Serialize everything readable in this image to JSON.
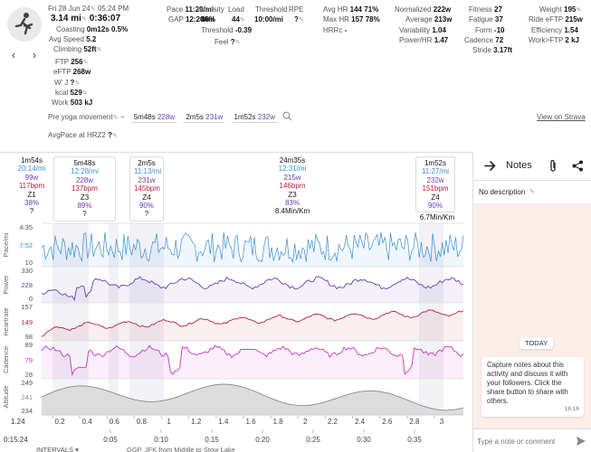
{
  "activity": {
    "date": "Fri 28 Jun 24",
    "time": "05:24 PM",
    "distance": "3.14 mi",
    "duration": "0:36:07",
    "coasting_label": "Coasting",
    "coasting_value": "0m12s",
    "coasting_pct": "0.5%",
    "avg_speed_label": "Avg Speed",
    "avg_speed": "5.2",
    "climbing_label": "Climbing",
    "climbing": "52ft",
    "ftp_label": "FTP",
    "ftp": "256",
    "eftp_label": "eFTP",
    "eftp": "268w",
    "wj_label": "W' J",
    "wj": "?",
    "kcal_label": "kcal",
    "kcal": "529",
    "work_label": "Work",
    "work": "503 kJ"
  },
  "col2": {
    "pace_label": "Pace",
    "pace": "11:29/mi",
    "gap_label": "GAP",
    "gap": "12:20/mi",
    "intensity_label": "Intensity",
    "intensity": "86%",
    "load_label": "Load",
    "load": "44",
    "threshold_top_label": "Threshold",
    "threshold_top": "10:00/mi",
    "rpe_label": "RPE",
    "rpe": "?",
    "threshold_label": "Threshold",
    "threshold": "-0.39",
    "feel_label": "Feel",
    "feel": "?"
  },
  "hr": {
    "avg_label": "Avg HR",
    "avg": "144",
    "avg_pct": "71%",
    "max_label": "Max HR",
    "max": "157",
    "max_pct": "78%",
    "hrrc_label": "HRRc",
    "hrrc": "-"
  },
  "power": {
    "normalized_label": "Normalized",
    "normalized": "222w",
    "average_label": "Average",
    "average": "213w",
    "variability_label": "Variability",
    "variability": "1.04",
    "powerhr_label": "Power/HR",
    "powerhr": "1.47"
  },
  "fitness": {
    "fitness_label": "Fitness",
    "fitness": "27",
    "fatigue_label": "Fatigue",
    "fatigue": "37",
    "form_label": "Form",
    "form": "-10",
    "cadence_label": "Cadence",
    "cadence": "72",
    "stride_label": "Stride",
    "stride": "3.17ft"
  },
  "weight": {
    "weight_label": "Weight",
    "weight": "195",
    "ride_eftp_label": "Ride eFTP",
    "ride_eftp": "215w",
    "efficiency_label": "Efficiency",
    "efficiency": "1.54",
    "work_ftp_label": "Work>FTP",
    "work_ftp": "2 kJ"
  },
  "movement": {
    "label": "Pre yoga movement",
    "tilde": "~",
    "items": [
      {
        "time": "5m48s",
        "watts": "228w"
      },
      {
        "time": "2m5s",
        "watts": "231w"
      },
      {
        "time": "1m52s",
        "watts": "232w"
      }
    ],
    "strava_link": "View on Strava"
  },
  "avgpace": {
    "label": "AvgPace at HRZ2",
    "value": "?"
  },
  "intervals": [
    {
      "dur": "1m54s",
      "pace": "20:14/mi",
      "watts": "99w",
      "bpm": "117bpm",
      "zone": "Z1",
      "pct": "38%",
      "q": "?",
      "extra": ""
    },
    {
      "dur": "5m48s",
      "pace": "12:28/mi",
      "watts": "228w",
      "bpm": "137bpm",
      "zone": "Z3",
      "pct": "89%",
      "q": "?",
      "extra": ""
    },
    {
      "dur": "2m5s",
      "pace": "11:13/mi",
      "watts": "231w",
      "bpm": "145bpm",
      "zone": "Z4",
      "pct": "90%",
      "q": "?",
      "extra": ""
    },
    {
      "dur": "24m35s",
      "pace": "12:31/mi",
      "watts": "215w",
      "bpm": "146bpm",
      "zone": "Z3",
      "pct": "83%",
      "q": "",
      "extra": "8.4Min/Km"
    },
    {
      "dur": "1m52s",
      "pace": "11:27/mi",
      "watts": "232w",
      "bpm": "151bpm",
      "zone": "Z4",
      "pct": "90%",
      "q": "",
      "extra": "6.7Min/Km"
    }
  ],
  "tracks": [
    {
      "name": "Pace/mi",
      "ticks": [
        "4:35",
        "7:52",
        "10"
      ],
      "color": "#3a8fd6"
    },
    {
      "name": "Power",
      "ticks": [
        "330",
        "228",
        "0"
      ],
      "color": "#6a3db3"
    },
    {
      "name": "Heartrate",
      "ticks": [
        "157",
        "149",
        "98"
      ],
      "color": "#b8203c"
    },
    {
      "name": "Cadence",
      "ticks": [
        "89",
        "79",
        "28"
      ],
      "color": "#cc33cc"
    },
    {
      "name": "Altitude",
      "ticks": [
        "249",
        "241",
        "234"
      ],
      "color": "#888888"
    }
  ],
  "distance_axis": {
    "start": "1.24",
    "labels": [
      "0.2",
      "0.4",
      "0.6",
      "0.8",
      "1",
      "1.2",
      "1.4",
      "1.6",
      "1.8",
      "2",
      "2.2",
      "2.4",
      "2.6",
      "2.8",
      "3"
    ]
  },
  "time_axis": {
    "start": "0:15:24",
    "labels": [
      "0:05",
      "0:10",
      "0:15",
      "0:20",
      "0:25",
      "0:30",
      "0:35"
    ]
  },
  "footer": {
    "intervals_label": "INTERVALS",
    "route": "GGP, JFK from Middle to Stow Lake"
  },
  "notes": {
    "title": "Notes",
    "description": "No description",
    "today": "TODAY",
    "message": "Capture notes about this activity and discuss it with your followers. Click the share button to share with others.",
    "message_time": "16:16",
    "placeholder": "Type a note or comment"
  },
  "colors": {
    "pace": "#3a8fd6",
    "power": "#6a3db3",
    "heartrate": "#b8203c",
    "cadence": "#cc33cc",
    "altitude": "#888888",
    "notes_bg": "#fbeee8"
  }
}
